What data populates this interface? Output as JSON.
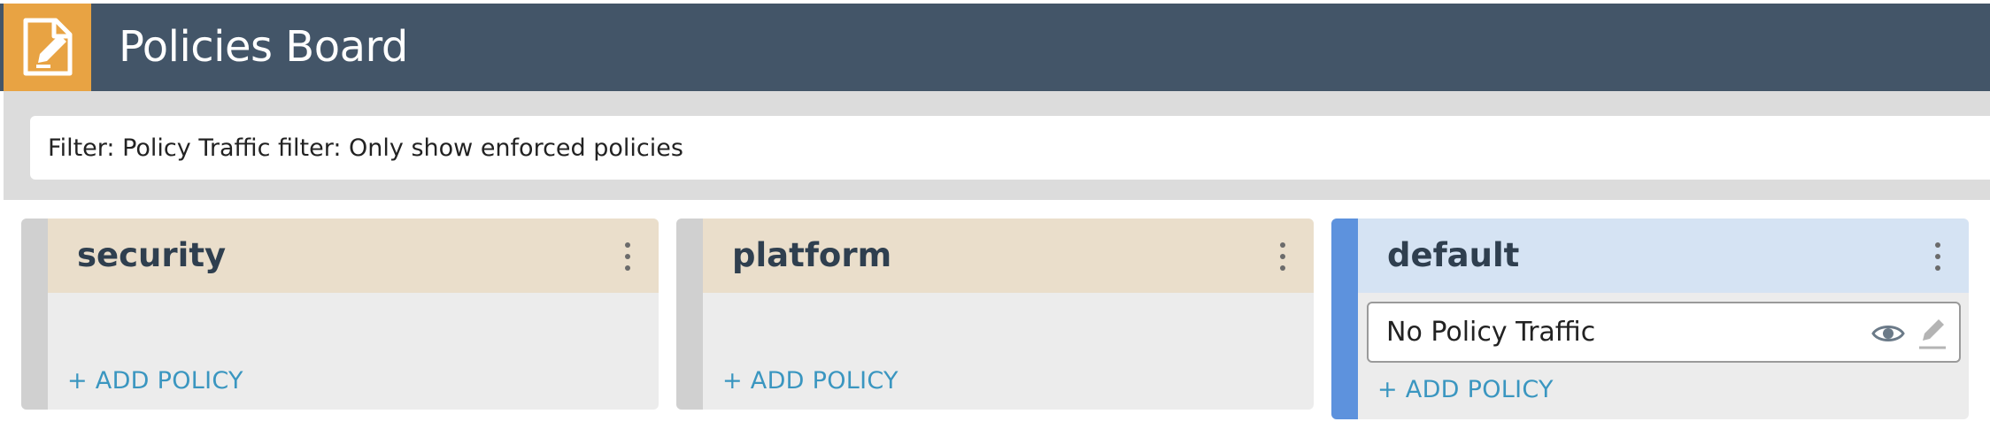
{
  "header": {
    "title": "Policies Board",
    "logo_icon": "policy-document-icon"
  },
  "filter": {
    "text": "Filter: Policy Traffic filter: Only show enforced policies"
  },
  "lanes": [
    {
      "title": "security",
      "add_label": "+ ADD POLICY",
      "policies": []
    },
    {
      "title": "platform",
      "add_label": "+ ADD POLICY",
      "policies": []
    },
    {
      "title": "default",
      "add_label": "+ ADD POLICY",
      "policies": [
        {
          "name": "No Policy Traffic",
          "actions": [
            "eye-icon",
            "pencil-icon"
          ]
        }
      ]
    }
  ],
  "colors": {
    "topbar": "#435568",
    "logo": "#e8a343",
    "lane_header": "#eadecb",
    "default_header": "#d5e3f3",
    "default_stripe": "#5d92dd",
    "link": "#3a96c0"
  }
}
